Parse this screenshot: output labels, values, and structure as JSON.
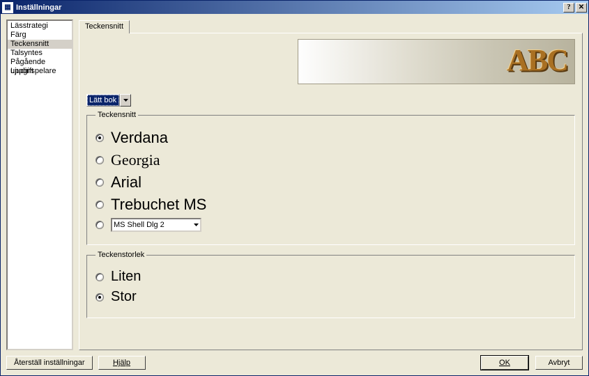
{
  "window": {
    "title": "Inställningar",
    "help_btn": "?",
    "close_btn": "✕"
  },
  "sidebar": {
    "items": [
      {
        "label": "Lässtrategi",
        "selected": false
      },
      {
        "label": "Färg",
        "selected": false
      },
      {
        "label": "Teckensnitt",
        "selected": true
      },
      {
        "label": "Talsyntes",
        "selected": false
      },
      {
        "label": "Pågående uppgift",
        "selected": false
      },
      {
        "label": "Ljudinspelare",
        "selected": false
      }
    ]
  },
  "tab": {
    "label": "Teckensnitt"
  },
  "banner": {
    "abc": "ABC"
  },
  "mode_select": {
    "value": "Lätt bok"
  },
  "font_group": {
    "legend": "Teckensnitt",
    "options": [
      {
        "label": "Verdana",
        "checked": true,
        "class": "font-label-verdana"
      },
      {
        "label": "Georgia",
        "checked": false,
        "class": "font-label-georgia"
      },
      {
        "label": "Arial",
        "checked": false,
        "class": "font-label-arial"
      },
      {
        "label": "Trebuchet MS",
        "checked": false,
        "class": "font-label-trebuchet"
      }
    ],
    "custom": {
      "checked": false,
      "value": "MS Shell Dlg 2"
    }
  },
  "size_group": {
    "legend": "Teckenstorlek",
    "options": [
      {
        "label": "Liten",
        "checked": false
      },
      {
        "label": "Stor",
        "checked": true
      }
    ]
  },
  "buttons": {
    "reset": "Återställ inställningar",
    "help": "Hjälp",
    "ok": "OK",
    "cancel": "Avbryt"
  }
}
